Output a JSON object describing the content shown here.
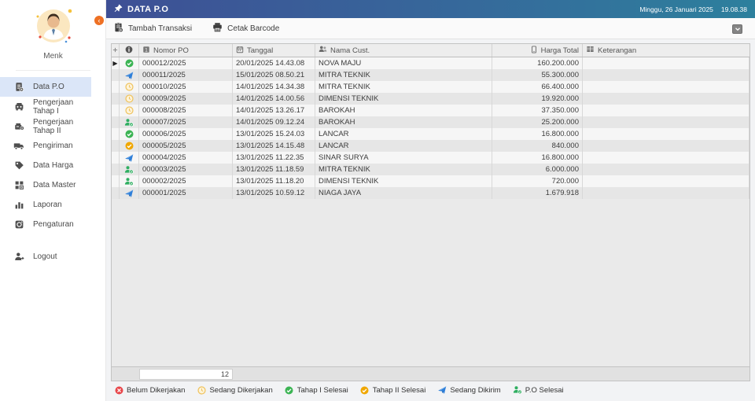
{
  "topbar": {
    "title": "DATA P.O",
    "date": "Minggu, 26 Januari 2025",
    "time": "19.08.38"
  },
  "toolbar": {
    "buttons": [
      {
        "label": "Tambah Transaksi",
        "icon": "clipboard-plus-icon"
      },
      {
        "label": "Cetak Barcode",
        "icon": "printer-icon"
      }
    ]
  },
  "sidebar": {
    "username": "Menk",
    "items": [
      {
        "label": "Data P.O",
        "icon": "document-icon",
        "active": true
      },
      {
        "label": "Pengerjaan Tahap I",
        "icon": "machine-one-icon",
        "active": false
      },
      {
        "label": "Pengerjaan Tahap II",
        "icon": "machine-two-icon",
        "active": false
      },
      {
        "label": "Pengiriman",
        "icon": "truck-icon",
        "active": false
      },
      {
        "label": "Data Harga",
        "icon": "price-tag-icon",
        "active": false
      },
      {
        "label": "Data Master",
        "icon": "data-master-icon",
        "active": false
      },
      {
        "label": "Laporan",
        "icon": "chart-icon",
        "active": false
      },
      {
        "label": "Pengaturan",
        "icon": "settings-icon",
        "active": false
      }
    ],
    "logout": {
      "label": "Logout",
      "icon": "logout-icon"
    }
  },
  "table": {
    "columns": [
      {
        "label": "Nomor PO",
        "icon": "number-icon",
        "class": "c-nomor"
      },
      {
        "label": "Tanggal",
        "icon": "calendar-icon",
        "class": "c-tgl"
      },
      {
        "label": "Nama Cust.",
        "icon": "people-icon",
        "class": "c-cust"
      },
      {
        "label": "Harga Total",
        "icon": "phone-icon",
        "class": "c-harga"
      },
      {
        "label": "Keterangan",
        "icon": "grid-icon",
        "class": "c-ket"
      }
    ],
    "rows": [
      {
        "selected": true,
        "status": "tahap1-selesai",
        "nomor": "000012/2025",
        "tanggal": "20/01/2025 14.43.08",
        "cust": "NOVA MAJU",
        "harga": "160.200.000",
        "keterangan": ""
      },
      {
        "selected": false,
        "status": "sedang-dikirim",
        "nomor": "000011/2025",
        "tanggal": "15/01/2025 08.50.21",
        "cust": "MITRA TEKNIK",
        "harga": "55.300.000",
        "keterangan": ""
      },
      {
        "selected": false,
        "status": "sedang-dikerjakan",
        "nomor": "000010/2025",
        "tanggal": "14/01/2025 14.34.38",
        "cust": "MITRA TEKNIK",
        "harga": "66.400.000",
        "keterangan": ""
      },
      {
        "selected": false,
        "status": "sedang-dikerjakan",
        "nomor": "000009/2025",
        "tanggal": "14/01/2025 14.00.56",
        "cust": "DIMENSI TEKNIK",
        "harga": "19.920.000",
        "keterangan": ""
      },
      {
        "selected": false,
        "status": "sedang-dikerjakan",
        "nomor": "000008/2025",
        "tanggal": "14/01/2025 13.26.17",
        "cust": "BAROKAH",
        "harga": "37.350.000",
        "keterangan": ""
      },
      {
        "selected": false,
        "status": "po-selesai",
        "nomor": "000007/2025",
        "tanggal": "14/01/2025 09.12.24",
        "cust": "BAROKAH",
        "harga": "25.200.000",
        "keterangan": ""
      },
      {
        "selected": false,
        "status": "tahap1-selesai",
        "nomor": "000006/2025",
        "tanggal": "13/01/2025 15.24.03",
        "cust": "LANCAR",
        "harga": "16.800.000",
        "keterangan": ""
      },
      {
        "selected": false,
        "status": "tahap2-selesai",
        "nomor": "000005/2025",
        "tanggal": "13/01/2025 14.15.48",
        "cust": "LANCAR",
        "harga": "840.000",
        "keterangan": ""
      },
      {
        "selected": false,
        "status": "sedang-dikirim",
        "nomor": "000004/2025",
        "tanggal": "13/01/2025 11.22.35",
        "cust": "SINAR SURYA",
        "harga": "16.800.000",
        "keterangan": ""
      },
      {
        "selected": false,
        "status": "po-selesai",
        "nomor": "000003/2025",
        "tanggal": "13/01/2025 11.18.59",
        "cust": "MITRA TEKNIK",
        "harga": "6.000.000",
        "keterangan": ""
      },
      {
        "selected": false,
        "status": "po-selesai",
        "nomor": "000002/2025",
        "tanggal": "13/01/2025 11.18.20",
        "cust": "DIMENSI TEKNIK",
        "harga": "720.000",
        "keterangan": ""
      },
      {
        "selected": false,
        "status": "sedang-dikirim",
        "nomor": "000001/2025",
        "tanggal": "13/01/2025 10.59.12",
        "cust": "NIAGA JAYA",
        "harga": "1.679.918",
        "keterangan": ""
      }
    ],
    "footer_count": "12"
  },
  "legend": {
    "items": [
      {
        "label": "Belum Dikerjakan",
        "status": "belum-dikerjakan"
      },
      {
        "label": "Sedang Dikerjakan",
        "status": "sedang-dikerjakan"
      },
      {
        "label": "Tahap I Selesai",
        "status": "tahap1-selesai"
      },
      {
        "label": "Tahap II Selesai",
        "status": "tahap2-selesai"
      },
      {
        "label": "Sedang Dikirim",
        "status": "sedang-dikirim"
      },
      {
        "label": "P.O Selesai",
        "status": "po-selesai"
      }
    ]
  },
  "colors": {
    "topbar_gradient_start": "#3e4f95",
    "topbar_gradient_end": "#2d809d",
    "active_item_bg": "#dbe6f8",
    "accent_orange": "#ee7023",
    "status_green": "#3cb454",
    "status_amber": "#f0a700",
    "status_clock_stroke": "#efc35e",
    "status_clock_fill": "#fdf3da",
    "status_blue": "#2e7fd9",
    "status_red": "#e8474b",
    "person_green": "#2eae60"
  }
}
